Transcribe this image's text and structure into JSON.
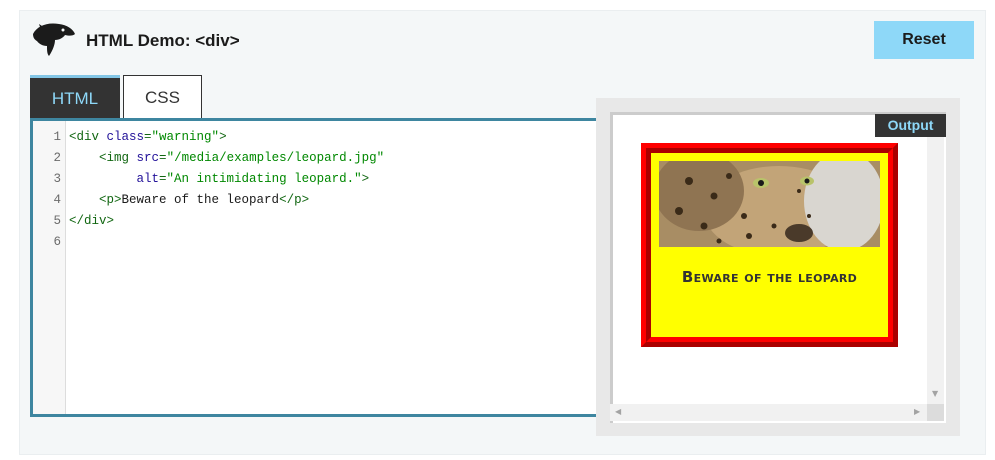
{
  "header": {
    "title": "HTML Demo: <div>",
    "logo_icon": "mdn-dinosaur-icon",
    "reset_label": "Reset"
  },
  "tabs": [
    {
      "label": "HTML",
      "active": true
    },
    {
      "label": "CSS",
      "active": false
    }
  ],
  "editor": {
    "line_numbers": [
      "1",
      "2",
      "3",
      "4",
      "5",
      "6"
    ],
    "lines": [
      [
        {
          "t": "tag",
          "v": "<div "
        },
        {
          "t": "attr",
          "v": "class"
        },
        {
          "t": "tag",
          "v": "="
        },
        {
          "t": "str",
          "v": "\"warning\""
        },
        {
          "t": "tag",
          "v": ">"
        }
      ],
      [
        {
          "t": "text",
          "v": "    "
        },
        {
          "t": "tag",
          "v": "<img "
        },
        {
          "t": "attr",
          "v": "src"
        },
        {
          "t": "tag",
          "v": "="
        },
        {
          "t": "str",
          "v": "\"/media/examples/leopard.jpg\""
        }
      ],
      [
        {
          "t": "text",
          "v": "         "
        },
        {
          "t": "attr",
          "v": "alt"
        },
        {
          "t": "tag",
          "v": "="
        },
        {
          "t": "str",
          "v": "\"An intimidating leopard.\""
        },
        {
          "t": "tag",
          "v": ">"
        }
      ],
      [
        {
          "t": "text",
          "v": "    "
        },
        {
          "t": "tag",
          "v": "<p>"
        },
        {
          "t": "text",
          "v": "Beware of the leopard"
        },
        {
          "t": "tag",
          "v": "</p>"
        }
      ],
      [
        {
          "t": "tag",
          "v": "</div>"
        }
      ],
      []
    ]
  },
  "output": {
    "label": "Output",
    "warning_text": "Beware of the leopard",
    "image_alt": "An intimidating leopard."
  },
  "colors": {
    "accent": "#8ed8f8",
    "editor_border": "#3e86a0",
    "warning_bg": "#ffff00",
    "warning_border": "#ff0000"
  }
}
